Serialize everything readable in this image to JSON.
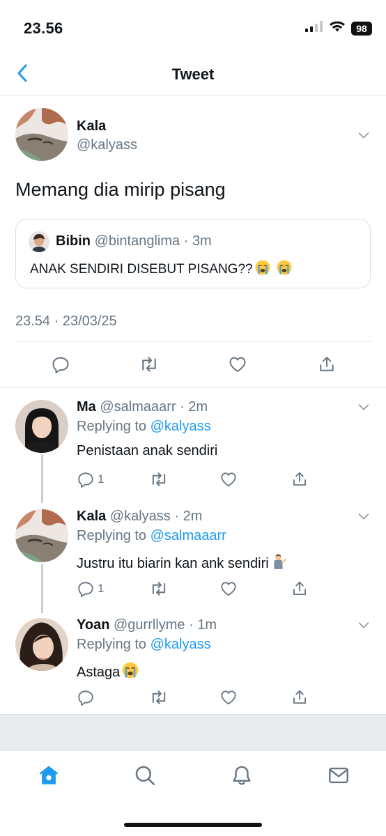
{
  "status_bar": {
    "time": "23.56",
    "battery": "98"
  },
  "nav": {
    "title": "Tweet"
  },
  "main_tweet": {
    "name": "Kala",
    "handle": "@kalyass",
    "text": "Memang dia mirip pisang",
    "timestamp": "23.54 · 23/03/25",
    "quote": {
      "name": "Bibin",
      "handle": "@bintanglima",
      "time": "3m",
      "text": "ANAK SENDIRI DISEBUT PISANG??"
    }
  },
  "replies": [
    {
      "name": "Ma",
      "handle": "@salmaaarr",
      "time": "2m",
      "replying_prefix": "Replying to ",
      "replying_to": "@kalyass",
      "text": "Penistaan anak sendiri",
      "reply_count": "1"
    },
    {
      "name": "Kala",
      "handle": "@kalyass",
      "time": "2m",
      "replying_prefix": "Replying to ",
      "replying_to": "@salmaaarr",
      "text": "Justru itu biarin kan ank sendiri",
      "reply_count": "1"
    },
    {
      "name": "Yoan",
      "handle": "@gurrllyme",
      "time": "1m",
      "replying_prefix": "Replying to ",
      "replying_to": "@kalyass",
      "text": "Astaga",
      "reply_count": ""
    }
  ],
  "icons": {
    "back": "chevron-left-icon",
    "caret": "chevron-down-icon",
    "reply": "reply-icon",
    "retweet": "retweet-icon",
    "like": "heart-icon",
    "share": "share-icon",
    "home": "home-icon",
    "search": "search-icon",
    "notifications": "bell-icon",
    "messages": "mail-icon",
    "crying_emoji": "loudly-crying-face-emoji",
    "shrug_emoji": "person-tipping-hand-emoji"
  },
  "colors": {
    "accent": "#1d9bf0",
    "secondary_text": "#687684",
    "primary_text": "#0f1419",
    "divider": "#e6e9ec"
  }
}
